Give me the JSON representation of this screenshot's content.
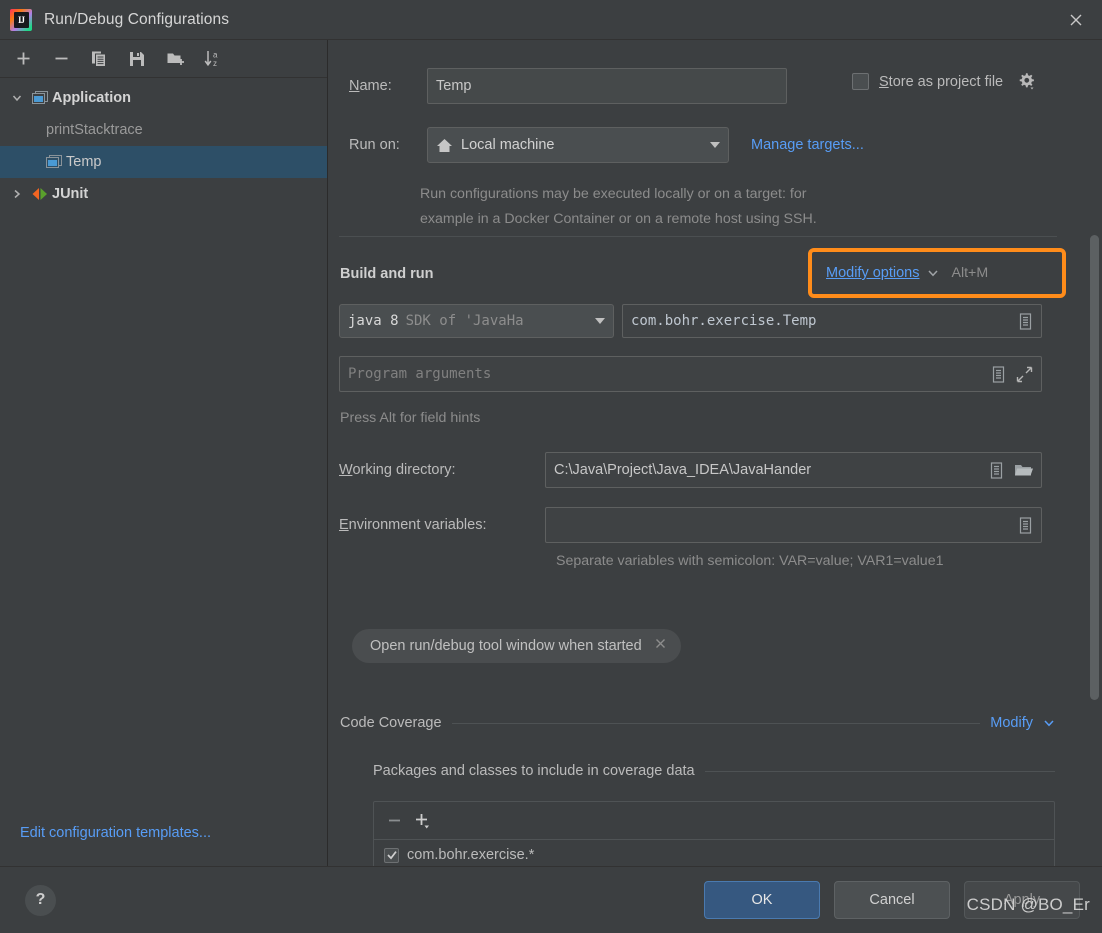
{
  "window": {
    "title": "Run/Debug Configurations",
    "logo_icon": "intellij-idea-logo",
    "logo_text": "IJ",
    "close_icon": "close-icon"
  },
  "left_panel": {
    "toolbar": [
      {
        "name": "add-configuration-button",
        "icon": "plus-icon"
      },
      {
        "name": "remove-configuration-button",
        "icon": "minus-icon"
      },
      {
        "name": "copy-configuration-button",
        "icon": "copy-icon"
      },
      {
        "name": "save-configuration-button",
        "icon": "save-icon"
      },
      {
        "name": "new-folder-button",
        "icon": "folder-add-icon"
      },
      {
        "name": "sort-configurations-button",
        "icon": "sort-az-icon"
      }
    ],
    "tree": [
      {
        "label": "Application",
        "icon": "application-icon",
        "twisty": "chevron-down-icon",
        "level": 0,
        "bold": true,
        "selected": false
      },
      {
        "label": "printStacktrace",
        "icon": "none",
        "twisty": "none",
        "level": 1,
        "bold": false,
        "selected": false
      },
      {
        "label": "Temp",
        "icon": "application-icon",
        "twisty": "none",
        "level": 1,
        "bold": false,
        "selected": true
      },
      {
        "label": "JUnit",
        "icon": "junit-icon",
        "twisty": "chevron-right-icon",
        "level": 0,
        "bold": true,
        "selected": false
      }
    ],
    "edit_templates_link": "Edit configuration templates..."
  },
  "form": {
    "name_label": "Name:",
    "name_label_mnemonic": "N",
    "name_value": "Temp",
    "store_as_project_file_label": "Store as project file",
    "store_as_project_file_mnemonic": "S",
    "store_as_project_file_checked": false,
    "store_gear_icon": "gear-dropdown-icon",
    "run_on_label": "Run on:",
    "run_on_value": "Local machine",
    "run_on_icon": "home-icon",
    "manage_targets_link": "Manage targets...",
    "run_on_hint_line1": "Run configurations may be executed locally or on a target: for",
    "run_on_hint_line2": "example in a Docker Container or on a remote host using SSH."
  },
  "build_and_run": {
    "section_title": "Build and run",
    "modify_options_link": "Modify options",
    "modify_options_shortcut": "Alt+M",
    "modify_options_caret_icon": "chevron-down-icon",
    "jdk_primary": "java 8",
    "jdk_secondary": "SDK of 'JavaHa",
    "main_class": "com.bohr.exercise.Temp",
    "main_class_browse_icon": "list-icon",
    "program_arguments_placeholder": "Program arguments",
    "program_args_list_icon": "list-icon",
    "program_args_expand_icon": "expand-icon",
    "field_hint": "Press Alt for field hints",
    "working_directory_label": "Working directory:",
    "working_directory_mnemonic": "W",
    "working_directory_value": "C:\\Java\\Project\\Java_IDEA\\JavaHander",
    "working_dir_list_icon": "list-icon",
    "working_dir_browse_icon": "folder-open-icon",
    "environment_variables_label": "Environment variables:",
    "environment_variables_mnemonic": "E",
    "environment_variables_value": "",
    "env_list_icon": "list-icon",
    "environment_hint": "Separate variables with semicolon: VAR=value; VAR1=value1",
    "open_tool_window_chip": "Open run/debug tool window when started",
    "chip_close_icon": "close-small-icon"
  },
  "code_coverage": {
    "section_title": "Code Coverage",
    "modify_link": "Modify",
    "modify_caret_icon": "chevron-down-icon",
    "packages_title": "Packages and classes to include in coverage data",
    "table_remove_icon": "minus-icon",
    "table_add_icon": "plus-dropdown-icon",
    "rows": [
      {
        "checked": true,
        "pattern": "com.bohr.exercise.*"
      }
    ]
  },
  "footer": {
    "help_label": "?",
    "ok_label": "OK",
    "cancel_label": "Cancel",
    "apply_label": "Apply"
  },
  "watermark": "CSDN @BO_Er",
  "colors": {
    "background": "#3c3f41",
    "selection": "#2d4f67",
    "link": "#589df6",
    "highlight": "#ff8c1a",
    "primary_button": "#365880"
  }
}
